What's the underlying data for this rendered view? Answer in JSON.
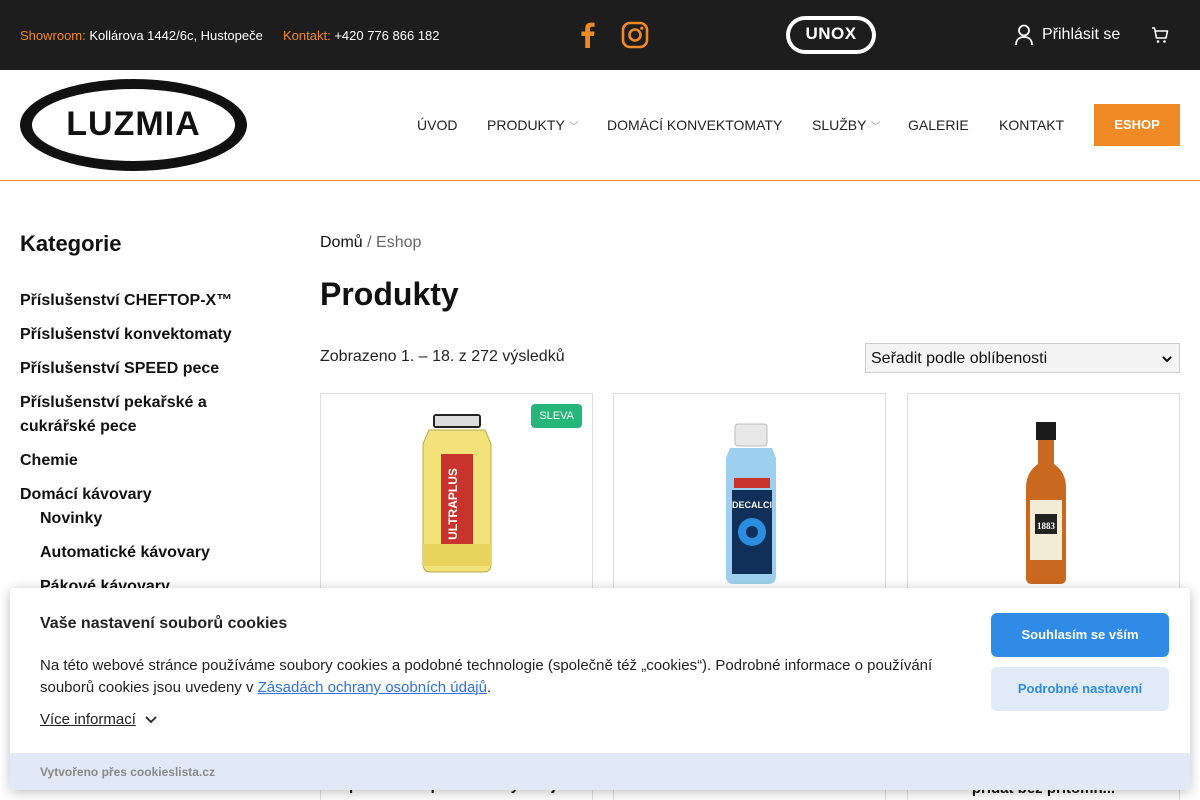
{
  "topbar": {
    "showroom_label": "Showroom:",
    "showroom_value": "Kollárova 1442/6c, Hustopeče",
    "contact_label": "Kontakt:",
    "contact_value": "+420 776 866 182",
    "social": [
      "facebook-icon",
      "instagram-icon"
    ],
    "partner_logo": "UNOX",
    "login_label": "Přihlásit se",
    "cart_icon": "cart-icon",
    "accent_color": "#f08a24"
  },
  "header": {
    "logo_text": "LUZMIA",
    "nav": [
      {
        "label": "ÚVOD",
        "dropdown": false
      },
      {
        "label": "PRODUKTY",
        "dropdown": true
      },
      {
        "label": "DOMÁCÍ KONVEKTOMATY",
        "dropdown": false
      },
      {
        "label": "SLUŽBY",
        "dropdown": true
      },
      {
        "label": "GALERIE",
        "dropdown": false
      },
      {
        "label": "KONTAKT",
        "dropdown": false
      }
    ],
    "eshop_label": "ESHOP"
  },
  "sidebar": {
    "title": "Kategorie",
    "categories": [
      {
        "label": "Příslušenství CHEFTOP-X™",
        "level": 0
      },
      {
        "label": "Příslušenství konvektomaty",
        "level": 0
      },
      {
        "label": "Příslušenství SPEED pece",
        "level": 0
      },
      {
        "label": "Příslušenství pekařské a cukrářské pece",
        "level": 0
      },
      {
        "label": "Chemie",
        "level": 0
      },
      {
        "label": "Domácí kávovary",
        "level": 0
      },
      {
        "label": "Novinky",
        "level": 1
      },
      {
        "label": "Automatické kávovary",
        "level": 1
      },
      {
        "label": "Pákové kávovary",
        "level": 1
      }
    ]
  },
  "main": {
    "breadcrumb_home": "Domů",
    "breadcrumb_sep": " / ",
    "breadcrumb_current": "Eshop",
    "title": "Produkty",
    "result_count": "Zobrazeno 1. – 18. z 272 výsledků",
    "sort_selected": "Seřadit podle oblíbenosti",
    "products": [
      {
        "badge": "SLEVA",
        "name": "prostředek pro všechny stroje"
      },
      {
        "badge": "",
        "name": ""
      },
      {
        "badge": "",
        "name": "přidat bez přítomn..."
      }
    ]
  },
  "cookie": {
    "title": "Vaše nastavení souborů cookies",
    "text_before_link": "Na této webové stránce používáme soubory cookies a podobné technologie (společně též „cookies“). Podrobné informace o používání souborů cookies jsou uvedeny v ",
    "link_text": "Zásadách ochrany osobních údajů",
    "text_after_link": ".",
    "more_label": "Více informací",
    "accept_label": "Souhlasím se vším",
    "settings_label": "Podrobné nastavení",
    "footer_text": "Vytvořeno přes cookieslista.cz"
  }
}
